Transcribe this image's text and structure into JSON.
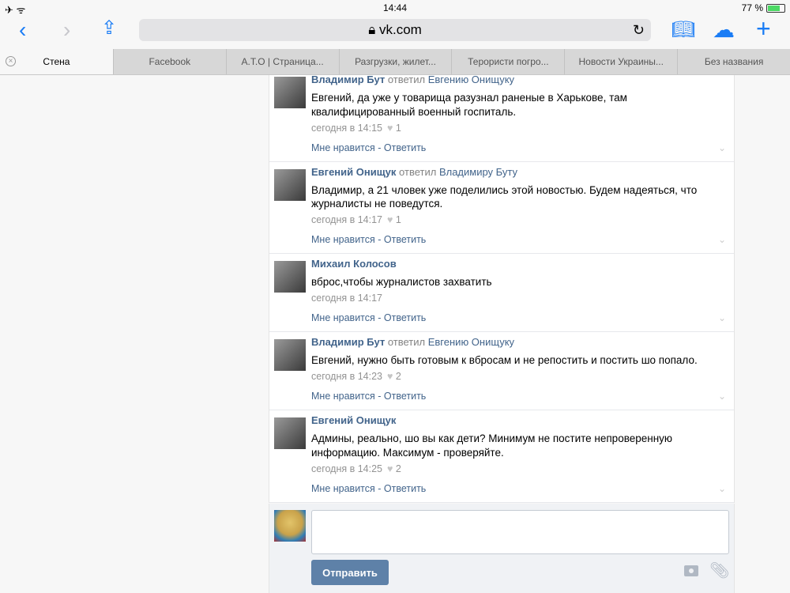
{
  "status": {
    "time": "14:44",
    "battery": "77 %",
    "battery_level": 0.77
  },
  "browser": {
    "url": "vk.com"
  },
  "tabs": [
    "Стена",
    "Facebook",
    "A.T.O | Страница...",
    "Разгрузки, жилет...",
    "Терористи погро...",
    "Новости Украины...",
    "Без названия"
  ],
  "comments": [
    {
      "author": "Владимир Бут",
      "replied": "ответил",
      "to": "Евгению Онищуку",
      "text": "Евгений, да уже у товарища разузнал раненые в Харькове, там квалифицированный военный госпиталь.",
      "time": "сегодня в 14:15",
      "likes": "1"
    },
    {
      "author": "Евгений Онищук",
      "replied": "ответил",
      "to": "Владимиру Буту",
      "text": "Владимир, а 21 чловек уже поделились этой новостью. Будем надеяться, что журналисты не поведутся.",
      "time": "сегодня в 14:17",
      "likes": "1"
    },
    {
      "author": "Михаил Колосов",
      "replied": "",
      "to": "",
      "text": "вброс,чтобы журналистов захватить",
      "time": "сегодня в 14:17",
      "likes": ""
    },
    {
      "author": "Владимир Бут",
      "replied": "ответил",
      "to": "Евгению Онищуку",
      "text": "Евгений, нужно быть готовым к вбросам и не репостить и постить шо попало.",
      "time": "сегодня в 14:23",
      "likes": "2"
    },
    {
      "author": "Евгений Онищук",
      "replied": "",
      "to": "",
      "text": "Админы, реально, шо вы как дети? Минимум не постите непроверенную информацию. Максимум - проверяйте.",
      "time": "сегодня в 14:25",
      "likes": "2"
    }
  ],
  "actions": {
    "like": "Мне нравится",
    "sep": " - ",
    "reply": "Ответить"
  },
  "composer": {
    "placeholder": "",
    "send": "Отправить"
  }
}
